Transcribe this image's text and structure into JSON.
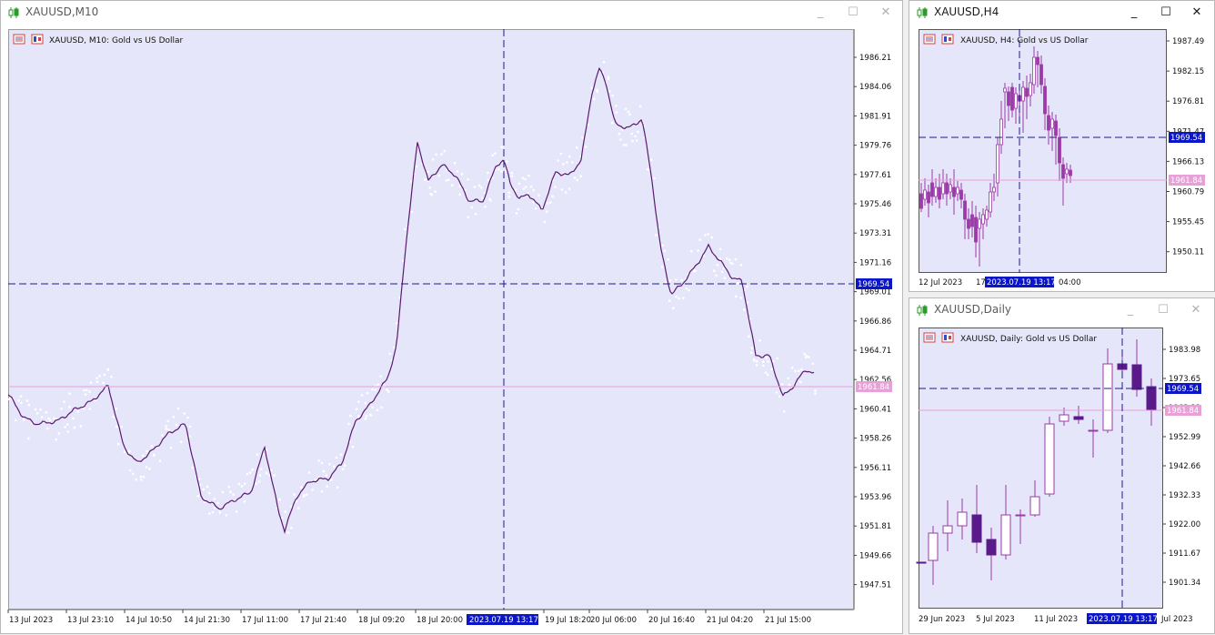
{
  "colors": {
    "chart_bg": "#e6e6fa",
    "line": "#5a1a6e",
    "dots": "#ffffff",
    "crosshair": "#1a1a8c",
    "bid_line": "#e8a0d8",
    "candle_up": "#9b3aa8",
    "candle_down": "#5a1a8a",
    "label_blue": "#0a16c8",
    "label_pink": "#e8a0d8"
  },
  "windows": {
    "m10": {
      "title": "XAUUSD,M10",
      "header_text": "XAUUSD, M10:  Gold vs US Dollar",
      "price_ticks": [
        "1986.21",
        "1984.06",
        "1981.91",
        "1979.76",
        "1977.61",
        "1975.46",
        "1973.31",
        "1971.16",
        "1969.01",
        "1966.86",
        "1964.71",
        "1962.56",
        "1960.41",
        "1958.26",
        "1956.11",
        "1953.96",
        "1951.81",
        "1949.66",
        "1947.51"
      ],
      "time_ticks": [
        "13 Jul 2023",
        "13 Jul 23:10",
        "14 Jul 10:50",
        "14 Jul 21:30",
        "17 Jul 11:00",
        "17 Jul 21:40",
        "18 Jul 09:20",
        "18 Jul 20:00",
        "19 Jul 18:20",
        "20 Jul 06:00",
        "20 Jul 16:40",
        "21 Jul 04:20",
        "21 Jul 15:00"
      ],
      "crosshair_price": "1969.54",
      "bid_price": "1961.84",
      "crosshair_time": "2023.07.19 13:17"
    },
    "h4": {
      "title": "XAUUSD,H4",
      "header_text": "XAUUSD, H4:  Gold vs US Dollar",
      "price_ticks": [
        "1987.49",
        "1982.15",
        "1976.81",
        "1971.47",
        "1966.13",
        "1960.79",
        "1955.45",
        "1950.11"
      ],
      "time_ticks": [
        "12 Jul 2023",
        "17",
        "04:00"
      ],
      "crosshair_price": "1969.54",
      "bid_price": "1961.84",
      "crosshair_time": "2023.07.19 13:17"
    },
    "daily": {
      "title": "XAUUSD,Daily",
      "header_text": "XAUUSD, Daily:  Gold vs US Dollar",
      "price_ticks": [
        "1983.98",
        "1973.65",
        "1963.32",
        "1952.99",
        "1942.66",
        "1932.33",
        "1922.00",
        "1911.67",
        "1901.34"
      ],
      "time_ticks": [
        "29 Jun 2023",
        "5 Jul 2023",
        "11 Jul 2023",
        "Jul 2023"
      ],
      "crosshair_price": "1969.54",
      "bid_price": "1961.84",
      "crosshair_time": "2023.07.19 13:17"
    }
  },
  "window_controls": {
    "minimize": "_",
    "maximize": "☐",
    "close": "✕"
  },
  "icons": {
    "window": "candlestick-icon",
    "header_list": "indicator-list-icon",
    "header_chart": "chart-type-icon"
  }
}
